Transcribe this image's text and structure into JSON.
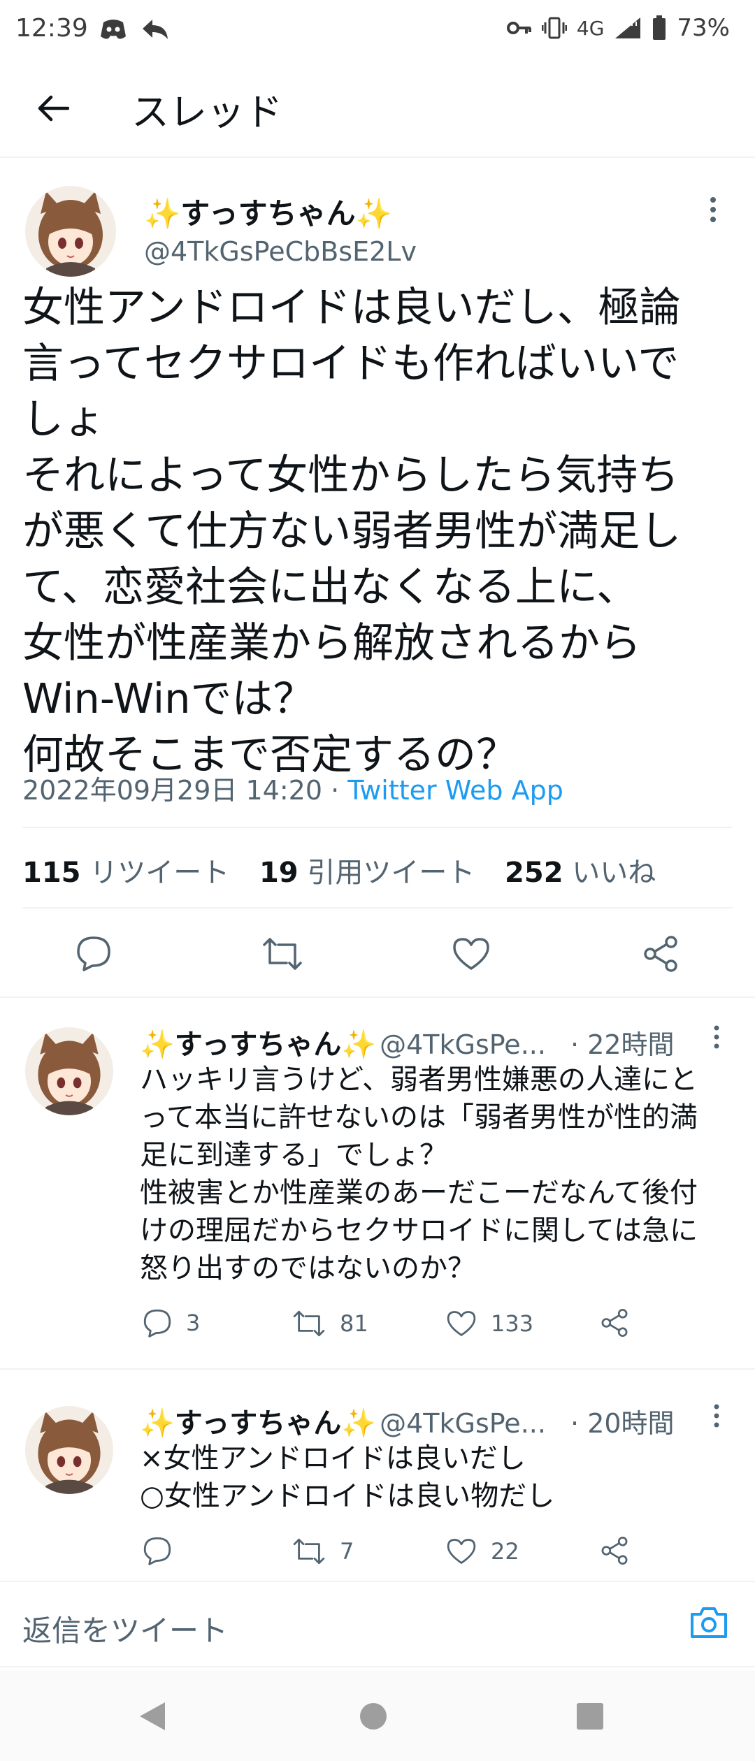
{
  "status": {
    "time": "12:39",
    "network": "4G",
    "battery": "73%"
  },
  "header": {
    "title": "スレッド"
  },
  "main_tweet": {
    "name": "✨すっすちゃん✨",
    "handle": "@4TkGsPeCbBsE2Lv",
    "body": "女性アンドロイドは良いだし、極論\n言ってセクサロイドも作ればいいで\nしょ\nそれによって女性からしたら気持ち\nが悪くて仕方ない弱者男性が満足し\nて、恋愛社会に出なくなる上に、\n女性が性産業から解放されるから\nWin-Winでは？\n何故そこまで否定するの？",
    "date": "2022年09月29日 14:20",
    "separator": " · ",
    "app": "Twitter Web App",
    "retweets": "115",
    "retweets_label": "リツイート",
    "quotes": "19",
    "quotes_label": "引用ツイート",
    "likes": "252",
    "likes_label": "いいね"
  },
  "replies": [
    {
      "name": "✨すっすちゃん✨",
      "handle": "@4TkGsPe...",
      "time": "· 22時間",
      "body": "ハッキリ言うけど、弱者男性嫌悪の人達にと\nって本当に許せないのは「弱者男性が性的満\n足に到達する」でしょ？\n性被害とか性産業のあーだこーだなんて後付\nけの理屈だからセクサロイドに関しては急に\n怒り出すのではないのか？",
      "replies": "3",
      "retweets": "81",
      "likes": "133"
    },
    {
      "name": "✨すっすちゃん✨",
      "handle": "@4TkGsPe...",
      "time": "· 20時間",
      "body": "×女性アンドロイドは良いだし\n○女性アンドロイドは良い物だし",
      "replies": "",
      "retweets": "7",
      "likes": "22"
    }
  ],
  "compose": {
    "placeholder": "返信をツイート"
  },
  "colors": {
    "accent": "#1d9bf0",
    "text": "#0f1419",
    "muted": "#536471"
  }
}
